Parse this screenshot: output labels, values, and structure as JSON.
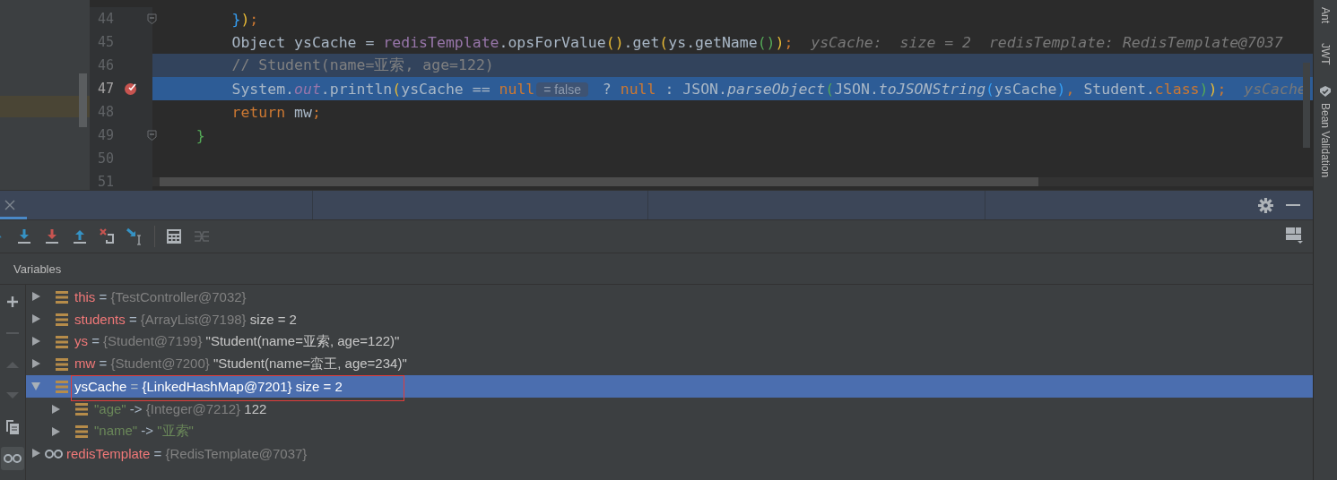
{
  "editor": {
    "lines": [
      {
        "number": "44",
        "fold": true,
        "breakpoint": false,
        "highlighted": false,
        "execution_point": false,
        "tokens": [
          {
            "t": "        }",
            "kind": "blue"
          },
          {
            "t": ")",
            "kind": "yellow"
          },
          {
            "t": ";",
            "kind": "keyword"
          }
        ]
      },
      {
        "number": "45",
        "fold": false,
        "breakpoint": false,
        "highlighted": false,
        "execution_point": false,
        "tokens": [
          {
            "t": "        Object ysCache = ",
            "kind": "plain"
          },
          {
            "t": "redisTemplate",
            "kind": "field"
          },
          {
            "t": ".opsForValue",
            "kind": "plain"
          },
          {
            "t": "()",
            "kind": "yellow"
          },
          {
            "t": ".get",
            "kind": "plain"
          },
          {
            "t": "(",
            "kind": "yellow"
          },
          {
            "t": "ys.getName",
            "kind": "plain"
          },
          {
            "t": "()",
            "kind": "green"
          },
          {
            "t": ")",
            "kind": "yellow"
          },
          {
            "t": ";",
            "kind": "keyword"
          },
          {
            "t": "  ysCache:  size = 2  redisTemplate: RedisTemplate@7037",
            "kind": "hint"
          }
        ]
      },
      {
        "number": "46",
        "fold": false,
        "breakpoint": false,
        "highlighted": true,
        "execution_point": false,
        "tokens": [
          {
            "t": "        // Student(name=亚索, age=122)",
            "kind": "comment"
          }
        ]
      },
      {
        "number": "47",
        "fold": false,
        "breakpoint": true,
        "highlighted": false,
        "execution_point": true,
        "tokens": [
          {
            "t": "        System.",
            "kind": "plain"
          },
          {
            "t": "out",
            "kind": "static"
          },
          {
            "t": ".println",
            "kind": "plain"
          },
          {
            "t": "(",
            "kind": "yellow"
          },
          {
            "t": "ysCache == ",
            "kind": "plain"
          },
          {
            "t": "null",
            "kind": "keyword"
          },
          {
            "t": "= false",
            "kind": "pill"
          },
          {
            "t": " ? ",
            "kind": "plain"
          },
          {
            "t": "null",
            "kind": "keyword"
          },
          {
            "t": " : JSON.",
            "kind": "plain"
          },
          {
            "t": "parseObject",
            "kind": "italic"
          },
          {
            "t": "(",
            "kind": "green"
          },
          {
            "t": "JSON.",
            "kind": "plain"
          },
          {
            "t": "toJSONString",
            "kind": "italic"
          },
          {
            "t": "(",
            "kind": "blue"
          },
          {
            "t": "ysCache",
            "kind": "plain"
          },
          {
            "t": ")",
            "kind": "blue"
          },
          {
            "t": ", ",
            "kind": "keyword"
          },
          {
            "t": "Student.",
            "kind": "plain"
          },
          {
            "t": "class",
            "kind": "keyword"
          },
          {
            "t": ")",
            "kind": "green"
          },
          {
            "t": ")",
            "kind": "yellow"
          },
          {
            "t": ";",
            "kind": "keyword"
          },
          {
            "t": "  ysCache",
            "kind": "hint"
          }
        ]
      },
      {
        "number": "48",
        "fold": false,
        "breakpoint": false,
        "highlighted": false,
        "execution_point": false,
        "tokens": [
          {
            "t": "        return",
            "kind": "keyword"
          },
          {
            "t": " mw",
            "kind": "plain"
          },
          {
            "t": ";",
            "kind": "keyword"
          }
        ]
      },
      {
        "number": "49",
        "fold": true,
        "breakpoint": false,
        "highlighted": false,
        "execution_point": false,
        "tokens": [
          {
            "t": "    }",
            "kind": "green"
          }
        ]
      },
      {
        "number": "50",
        "fold": false,
        "breakpoint": false,
        "highlighted": false,
        "execution_point": false
      },
      {
        "number": "51",
        "fold": false,
        "breakpoint": false,
        "highlighted": false,
        "execution_point": false
      }
    ]
  },
  "tool_strip": [
    "Ant",
    "JWT",
    "Bean Validation"
  ],
  "variables": {
    "title": "Variables",
    "items": [
      {
        "kind": "field",
        "name": "this",
        "separator": "=",
        "type": "{TestController@7032}",
        "expanded": false,
        "selected": false,
        "outlined": false
      },
      {
        "kind": "field",
        "name": "students",
        "separator": "=",
        "type": "{ArrayList@7198}",
        "value": "size = 2",
        "expanded": false,
        "selected": false,
        "outlined": false
      },
      {
        "kind": "field",
        "name": "ys",
        "separator": "=",
        "type": "{Student@7199}",
        "value": "\"Student(name=亚索, age=122)\"",
        "expanded": false,
        "selected": false,
        "outlined": false
      },
      {
        "kind": "field",
        "name": "mw",
        "separator": "=",
        "type": "{Student@7200}",
        "value": "\"Student(name=蛮王, age=234)\"",
        "expanded": false,
        "selected": false,
        "outlined": false
      },
      {
        "kind": "field",
        "name": "ysCache",
        "separator": "=",
        "type": "{LinkedHashMap@7201}",
        "value": "size = 2",
        "expanded": true,
        "selected": true,
        "outlined": true,
        "children": [
          {
            "key": "\"age\"",
            "separator": "->",
            "type": "{Integer@7212}",
            "value": "122",
            "is_string": false
          },
          {
            "key": "\"name\"",
            "separator": "->",
            "value": "\"亚索\"",
            "is_string": true
          }
        ]
      },
      {
        "kind": "watch",
        "name": "redisTemplate",
        "separator": "=",
        "type": "{RedisTemplate@7037}",
        "expanded": false,
        "selected": false,
        "outlined": false
      }
    ]
  }
}
